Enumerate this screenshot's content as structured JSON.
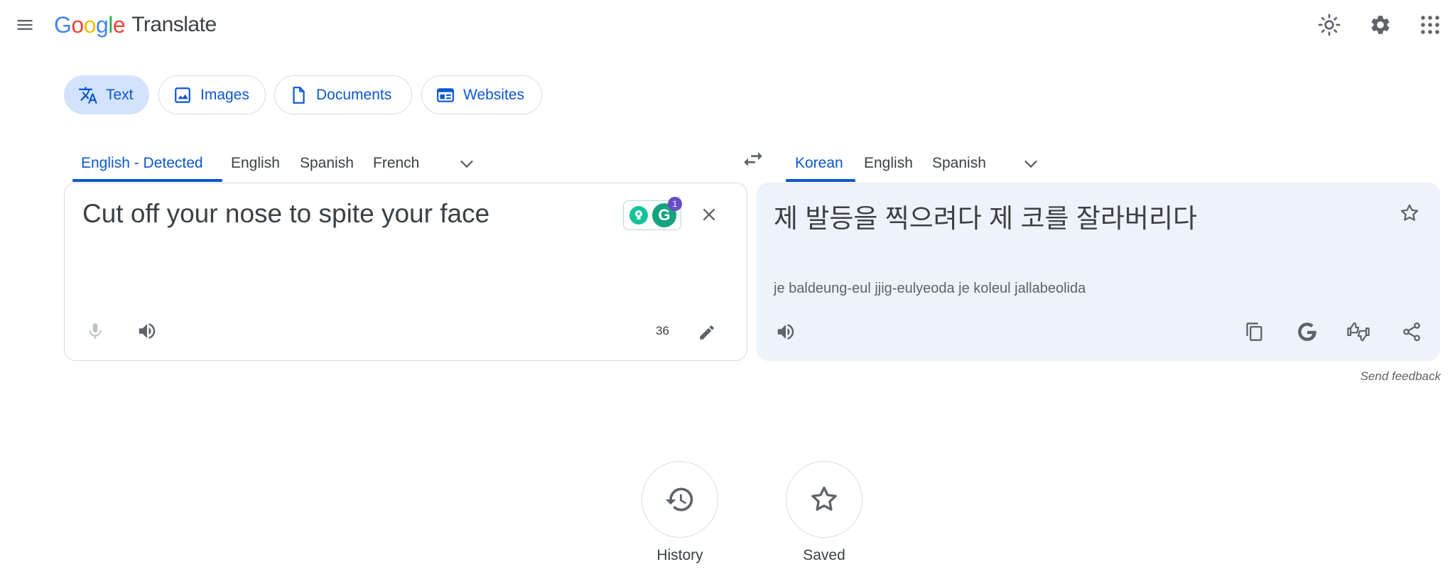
{
  "header": {
    "logo_letters": [
      "G",
      "o",
      "o",
      "g",
      "l",
      "e"
    ],
    "product": "Translate"
  },
  "modes": [
    {
      "label": "Text",
      "active": true
    },
    {
      "label": "Images",
      "active": false
    },
    {
      "label": "Documents",
      "active": false
    },
    {
      "label": "Websites",
      "active": false
    }
  ],
  "source_langs": [
    "English - Detected",
    "English",
    "Spanish",
    "French"
  ],
  "target_langs": [
    "Korean",
    "English",
    "Spanish"
  ],
  "source": {
    "text": "Cut off your nose to spite your face",
    "char_count": "36",
    "grammarly_badge": "1"
  },
  "target": {
    "text": "제 발등을 찍으려다 제 코를 잘라버리다",
    "romanization": "je baldeung-eul jjig-eulyeoda je koleul jallabeolida"
  },
  "feedback": "Send feedback",
  "bottom": {
    "history": "History",
    "saved": "Saved"
  },
  "colors": {
    "accent": "#0b57d0",
    "chip_active_bg": "#d3e3fd",
    "target_panel_bg": "#eef2fa"
  }
}
